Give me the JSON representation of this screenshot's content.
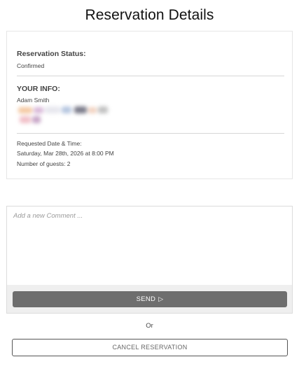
{
  "page": {
    "title": "Reservation Details"
  },
  "reservation": {
    "status_label": "Reservation Status:",
    "status_value": "Confirmed"
  },
  "your_info": {
    "label": "YOUR INFO:",
    "name": "Adam Smith"
  },
  "request": {
    "datetime_label": "Requested Date & Time:",
    "datetime_value": "Saturday, Mar 28th, 2026 at 8:00 PM",
    "guests": "Number of guests: 2"
  },
  "comment": {
    "placeholder": "Add a new Comment ...",
    "value": "",
    "send_label": "SEND",
    "send_icon": "send-arrow-icon"
  },
  "footer": {
    "or_text": "Or",
    "cancel_label": "CANCEL RESERVATION"
  },
  "colors": {
    "send_button": "#6e6e6e",
    "card_border": "#e6e6e6",
    "divider": "#d6d6d6"
  }
}
